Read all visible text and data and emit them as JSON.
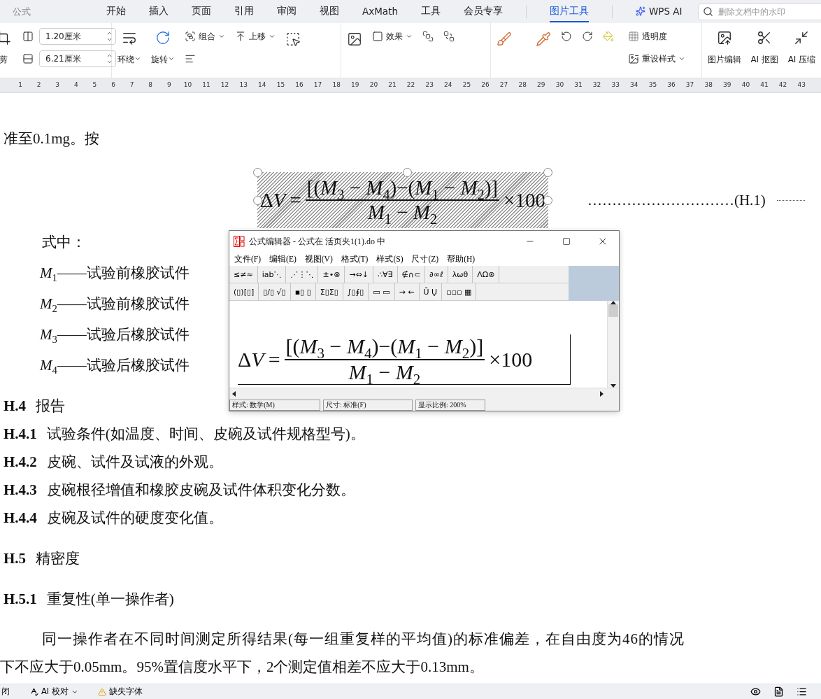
{
  "title_bar": {
    "quick_label": "公式",
    "tabs": [
      {
        "label": "开始",
        "selected": false
      },
      {
        "label": "插入",
        "selected": false
      },
      {
        "label": "页面",
        "selected": false
      },
      {
        "label": "引用",
        "selected": false
      },
      {
        "label": "审阅",
        "selected": false
      },
      {
        "label": "视图",
        "selected": false
      },
      {
        "label": "AxMath",
        "selected": false
      },
      {
        "label": "工具",
        "selected": false
      },
      {
        "label": "会员专享",
        "selected": false
      },
      {
        "label": "图片工具",
        "selected": true
      },
      {
        "label": "WPS AI",
        "selected": false
      }
    ],
    "search": {
      "placeholder": "删除文档中的水印"
    }
  },
  "ribbon": {
    "crop_label": "剪",
    "size_fields": [
      {
        "value": "1.20厘米"
      },
      {
        "value": "6.21厘米"
      }
    ],
    "tools": [
      {
        "label": "环绕"
      },
      {
        "label": "旋转"
      },
      {
        "label": "组合"
      },
      {
        "label": "上移"
      },
      {
        "label": "效果"
      },
      {
        "label": "透明度"
      },
      {
        "label": "重设样式"
      },
      {
        "label": "图片编辑"
      },
      {
        "label": "AI 抠图"
      },
      {
        "label": "AI 压缩"
      }
    ]
  },
  "ruler": {
    "numbers": [
      "1",
      "2",
      "3",
      "4",
      "5",
      "6",
      "7",
      "8",
      "9",
      "10",
      "11",
      "12",
      "13",
      "14",
      "15",
      "16",
      "17",
      "18",
      "19",
      "20",
      "21",
      "22",
      "23",
      "24",
      "25",
      "26",
      "27",
      "28",
      "29",
      "30",
      "31",
      "32",
      "33",
      "34",
      "35",
      "36",
      "37",
      "38",
      "39",
      "40",
      "41",
      "42",
      "43"
    ]
  },
  "document": {
    "blocks": [
      {
        "kind": "line",
        "text": "准至0.1mg。按"
      },
      {
        "kind": "equation",
        "delta": "Δ",
        "variable": "V",
        "sign": "=",
        "numerator": "[(*M*$_{3}$ − *M*$_{4}$)−(*M*$_{1}$ − *M*$_{2}$)]",
        "denominator": "*M*$_{1}$ − *M*$_{2}$",
        "factor": "×100",
        "selected": true,
        "number": "…………………………(H.1)"
      },
      {
        "kind": "label",
        "text": "式中："
      },
      {
        "kind": "symbol",
        "text": "*M*$_{1}$——试验前橡胶试件"
      },
      {
        "kind": "symbol",
        "text": "*M*$_{2}$——试验前橡胶试件"
      },
      {
        "kind": "symbol",
        "text": "*M*$_{3}$——试验后橡胶试件"
      },
      {
        "kind": "symbol",
        "text": "*M*$_{4}$——试验后橡胶试件"
      },
      {
        "kind": "heading",
        "number": "H.4",
        "text": "报告"
      },
      {
        "kind": "item",
        "number": "H.4.1",
        "text": "试验条件(如温度、时间、皮碗及试件规格型号)。"
      },
      {
        "kind": "item",
        "number": "H.4.2",
        "text": "皮碗、试件及试液的外观。"
      },
      {
        "kind": "item",
        "number": "H.4.3",
        "text": "皮碗根径增值和橡胶皮碗及试件体积变化分数。"
      },
      {
        "kind": "item",
        "number": "H.4.4",
        "text": "皮碗及试件的硬度变化值。"
      },
      {
        "kind": "heading",
        "number": "H.5",
        "text": "精密度"
      },
      {
        "kind": "heading",
        "number": "H.5.1",
        "text": "重复性(单一操作者)"
      },
      {
        "kind": "paragraph",
        "lines": [
          "同一操作者在不同时间测定所得结果(每一组重复样的平均值)的标准偏差，在自由度为46的情况",
          "下不应大于0.05mm。95%置信度水平下，2个测定值相差不应大于0.13mm。"
        ]
      }
    ]
  },
  "equation_editor": {
    "title": "公式编辑器 - 公式在 活页夹1(1).do 中",
    "menu": [
      "文件(F)",
      "编辑(E)",
      "视图(V)",
      "格式(T)",
      "样式(S)",
      "尺寸(Z)",
      "帮助(H)"
    ],
    "palette_rows": [
      [
        "≤≠≈",
        "ⅰab⋱",
        "⋰⋮⋱",
        "±•⊗",
        "→⇔↓",
        "∴∀∃",
        "∉∩⊂",
        "∂∞ℓ",
        "λωθ",
        "ΛΩ⊛"
      ],
      [
        "(▯)[▯]",
        "▯∕▯ √▯",
        "▪▯ ▯",
        "Σ▯Σ▯",
        "∫▯∮▯",
        "▭ ▭",
        "→ ←",
        "Ū Ų",
        "▫▫▫ ▦"
      ]
    ],
    "equation": {
      "delta": "Δ",
      "variable": "V",
      "sign": "=",
      "numerator": "[(*M*$_{3}$ − *M*$_{4}$)−(*M*$_{1}$ − *M*$_{2}$)]",
      "denominator": "*M*$_{1}$ − *M*$_{2}$",
      "factor": "×100"
    },
    "status": [
      "样式: 数学(M)",
      "尺寸: 标准(F)",
      "显示比例: 200%"
    ]
  },
  "status_bar": {
    "items": [
      "闭",
      "AI 校对",
      "缺失字体"
    ]
  }
}
